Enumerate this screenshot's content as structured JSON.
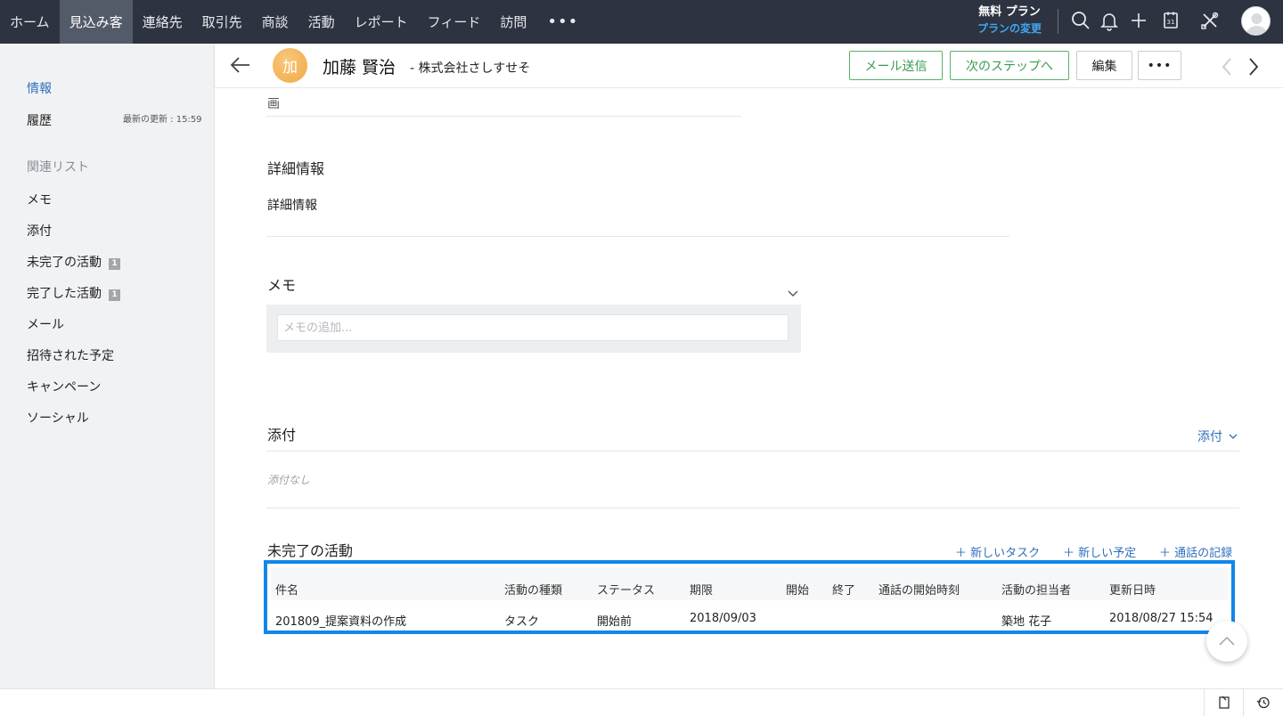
{
  "topnav": {
    "tabs": [
      "ホーム",
      "見込み客",
      "連絡先",
      "取引先",
      "商談",
      "活動",
      "レポート",
      "フィード",
      "訪問"
    ],
    "active_index": 1,
    "more": "•••",
    "plan_name": "無料 プラン",
    "plan_change": "プランの変更",
    "icons": [
      "search-icon",
      "bell-icon",
      "plus-icon",
      "calendar-icon",
      "tools-icon",
      "avatar"
    ]
  },
  "sidebar": {
    "info": "情報",
    "history": "履歴",
    "last_updated": "最新の更新 : 15:59",
    "related_lists_heading": "関連リスト",
    "items": [
      {
        "label": "メモ",
        "badge": ""
      },
      {
        "label": "添付",
        "badge": ""
      },
      {
        "label": "未完了の活動",
        "badge": "1"
      },
      {
        "label": "完了した活動",
        "badge": "1"
      },
      {
        "label": "メール",
        "badge": ""
      },
      {
        "label": "招待された予定",
        "badge": ""
      },
      {
        "label": "キャンペーン",
        "badge": ""
      },
      {
        "label": "ソーシャル",
        "badge": ""
      }
    ]
  },
  "record": {
    "avatar_initial": "加",
    "name": "加藤 賢治",
    "company": "- 株式会社さしすせそ",
    "buttons": {
      "send_mail": "メール送信",
      "next_step": "次のステップへ",
      "edit": "編集",
      "more": "•••"
    }
  },
  "sections": {
    "partial_top_text": "画",
    "detail": {
      "title": "詳細情報",
      "field_label": "詳細情報"
    },
    "memo": {
      "title": "メモ",
      "placeholder": "メモの追加..."
    },
    "attachments": {
      "title": "添付",
      "action": "添付",
      "empty": "添付なし"
    },
    "open_activities": {
      "title": "未完了の活動",
      "actions": [
        "＋ 新しいタスク",
        "＋ 新しい予定",
        "＋ 通話の記録"
      ],
      "columns": [
        "件名",
        "活動の種類",
        "ステータス",
        "期限",
        "開始",
        "終了",
        "通話の開始時刻",
        "活動の担当者",
        "更新日時"
      ],
      "rows": [
        [
          "201809_提案資料の作成",
          "タスク",
          "開始前",
          "2018/09/03",
          "",
          "",
          "",
          "築地 花子",
          "2018/08/27 15:54"
        ]
      ]
    }
  },
  "colors": {
    "nav_bg": "#2d3340",
    "nav_active": "#535a68",
    "link_blue": "#2f6fbe",
    "highlight_border": "#1187e9",
    "button_green": "#58b26a"
  }
}
